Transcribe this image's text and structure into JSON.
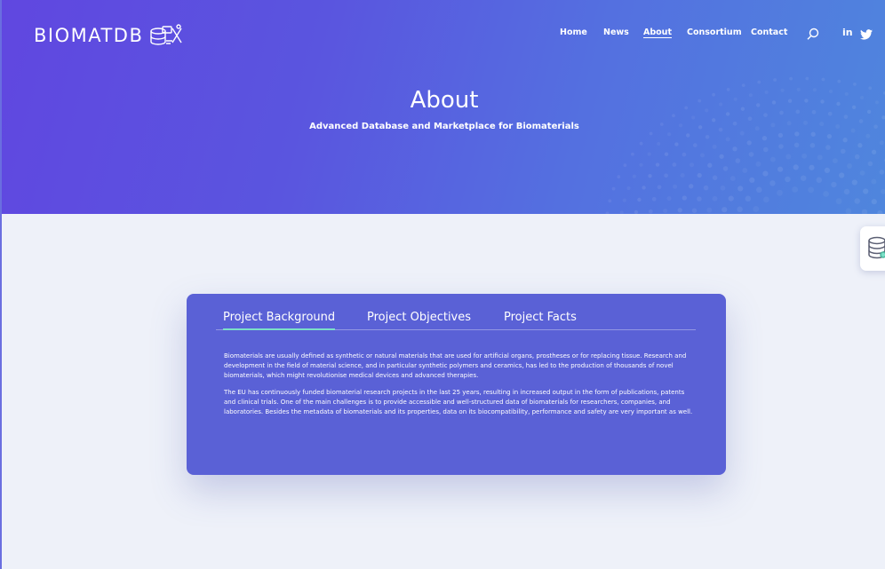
{
  "header": {
    "logo_text": "BIOMATDB",
    "nav": [
      {
        "label": "Home",
        "active": false
      },
      {
        "label": "News",
        "active": false
      },
      {
        "label": "About",
        "active": true
      },
      {
        "label": "Consortium",
        "active": false
      },
      {
        "label": "Contact",
        "active": false
      }
    ],
    "icons": [
      "search-icon",
      "linkedin-icon",
      "twitter-icon"
    ],
    "linkedin_glyph": "in"
  },
  "hero": {
    "title": "About",
    "subtitle": "Advanced Database and Marketplace for Biomaterials"
  },
  "tabs": [
    {
      "label": "Project Background",
      "active": true
    },
    {
      "label": "Project Objectives",
      "active": false
    },
    {
      "label": "Project Facts",
      "active": false
    }
  ],
  "content": {
    "paragraphs": [
      "Biomaterials are usually defined as synthetic or natural materials that are used for artificial organs, prostheses or for replacing tissue. Research and development in the field of material science, and in particular synthetic polymers and ceramics, has led to the production of thousands of novel biomaterials, which might revolutionise medical devices and advanced therapies.",
      "The EU has continuously funded biomaterial research projects in the last 25 years, resulting in increased output in the form of publications, patents and clinical trials. One of the main challenges is to provide accessible and well-structured data of biomaterials for researchers, companies, and laboratories. Besides the metadata of biomaterials and its properties, data on its biocompatibility, performance and safety are very important as well."
    ]
  },
  "colors": {
    "hero_start": "#6047e0",
    "hero_end": "#4f86dd",
    "card_bg": "#5a61d6",
    "tab_active_underline": "#7be0c8",
    "page_bg": "#eef1f9"
  }
}
